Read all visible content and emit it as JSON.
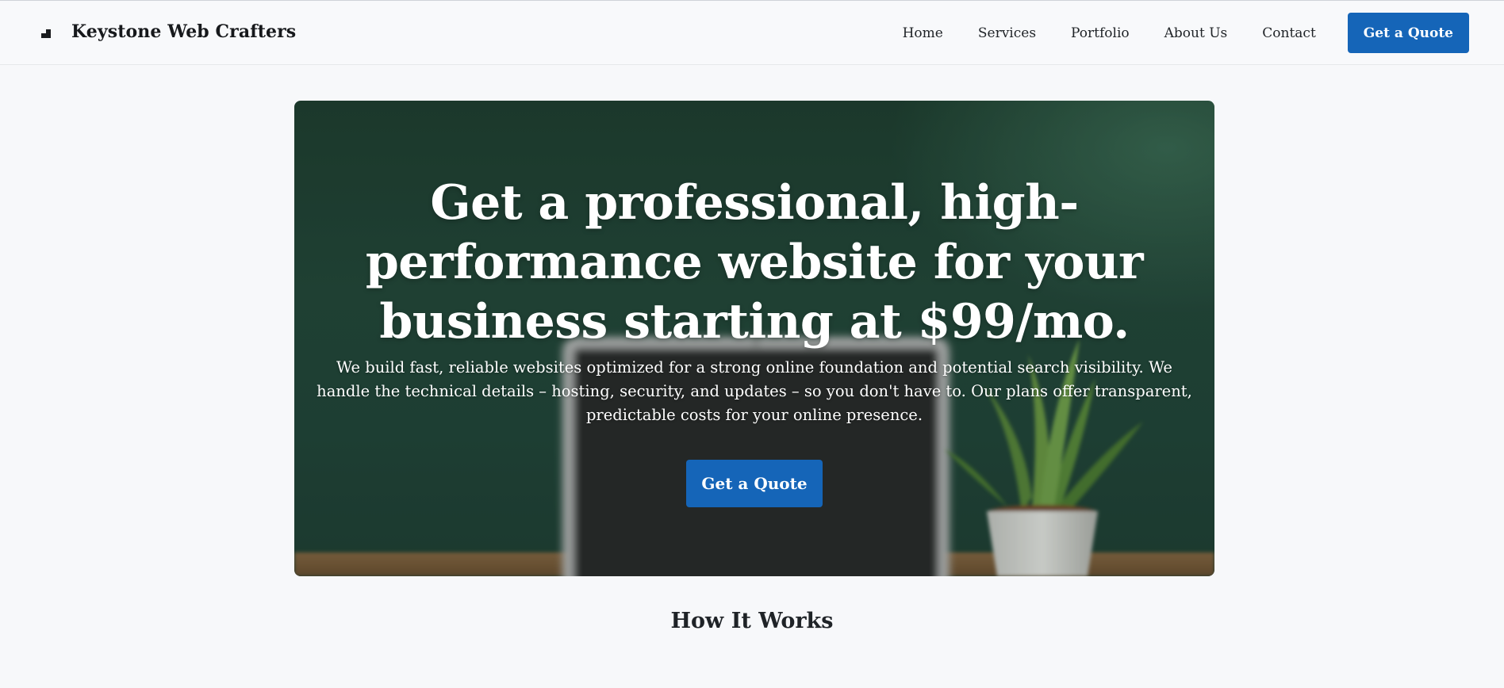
{
  "header": {
    "brand_name": "Keystone Web Crafters",
    "brand_icon": "stairs-logo-icon",
    "nav": [
      {
        "label": "Home"
      },
      {
        "label": "Services"
      },
      {
        "label": "Portfolio"
      },
      {
        "label": "About Us"
      },
      {
        "label": "Contact"
      }
    ],
    "cta_label": "Get a Quote"
  },
  "hero": {
    "title": "Get a professional, high-performance website for your business starting at $99/mo.",
    "subtitle": "We build fast, reliable websites optimized for a strong online foundation and potential search visibility. We handle the technical details – hosting, security, and updates – so you don't have to. Our plans offer transparent, predictable costs for your online presence.",
    "cta_label": "Get a Quote",
    "background_image": "blurred-laptop-and-plant-on-desk"
  },
  "sections": {
    "how_it_works_title": "How It Works"
  },
  "colors": {
    "accent": "#1565b8",
    "page_background": "#f7f8fa",
    "text": "#1f2327",
    "hero_green": "#24483a"
  }
}
